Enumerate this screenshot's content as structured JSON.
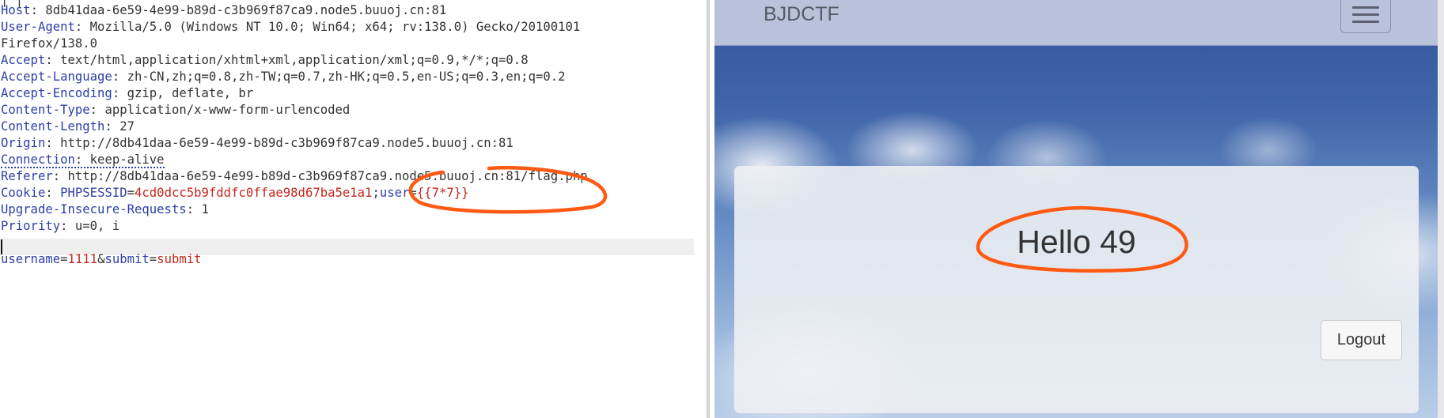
{
  "request": {
    "headers": [
      {
        "name": "Host",
        "value": "8db41daa-6e59-4e99-b89d-c3b969f87ca9.node5.buuoj.cn:81"
      },
      {
        "name": "User-Agent",
        "value": "Mozilla/5.0 (Windows NT 10.0; Win64; x64; rv:138.0) Gecko/20100101"
      },
      {
        "name": "",
        "value": "Firefox/138.0"
      },
      {
        "name": "Accept",
        "value": "text/html,application/xhtml+xml,application/xml;q=0.9,*/*;q=0.8"
      },
      {
        "name": "Accept-Language",
        "value": "zh-CN,zh;q=0.8,zh-TW;q=0.7,zh-HK;q=0.5,en-US;q=0.3,en;q=0.2"
      },
      {
        "name": "Accept-Encoding",
        "value": "gzip, deflate, br"
      },
      {
        "name": "Content-Type",
        "value": "application/x-www-form-urlencoded"
      },
      {
        "name": "Content-Length",
        "value": "27"
      },
      {
        "name": "Origin",
        "value": "http://8db41daa-6e59-4e99-b89d-c3b969f87ca9.node5.buuoj.cn:81"
      },
      {
        "name": "Connection",
        "value": "keep-alive"
      },
      {
        "name": "Referer",
        "value": "http://8db41daa-6e59-4e99-b89d-c3b969f87ca9.node5.buuoj.cn:81/flag.php"
      }
    ],
    "cookie": {
      "name": "Cookie",
      "sessid_key": "PHPSESSID",
      "sessid_value": "4cd0dcc5b9fddfc0ffae98d67ba5e1a1",
      "user_key": "user",
      "user_value": "{{7*7}}"
    },
    "headers_after": [
      {
        "name": "Upgrade-Insecure-Requests",
        "value": "1"
      },
      {
        "name": "Priority",
        "value": "u=0, i"
      }
    ],
    "body": {
      "key1": "username",
      "val1": "1111",
      "key2": "submit",
      "val2": "submit"
    }
  },
  "page": {
    "brand": "BJDCTF",
    "greeting": "Hello 49",
    "logout_label": "Logout"
  },
  "colors": {
    "header_name": "#2c3fa8",
    "param_value": "#c4261d",
    "annotation": "#ff5a14",
    "navbar": "#b8c2da"
  }
}
